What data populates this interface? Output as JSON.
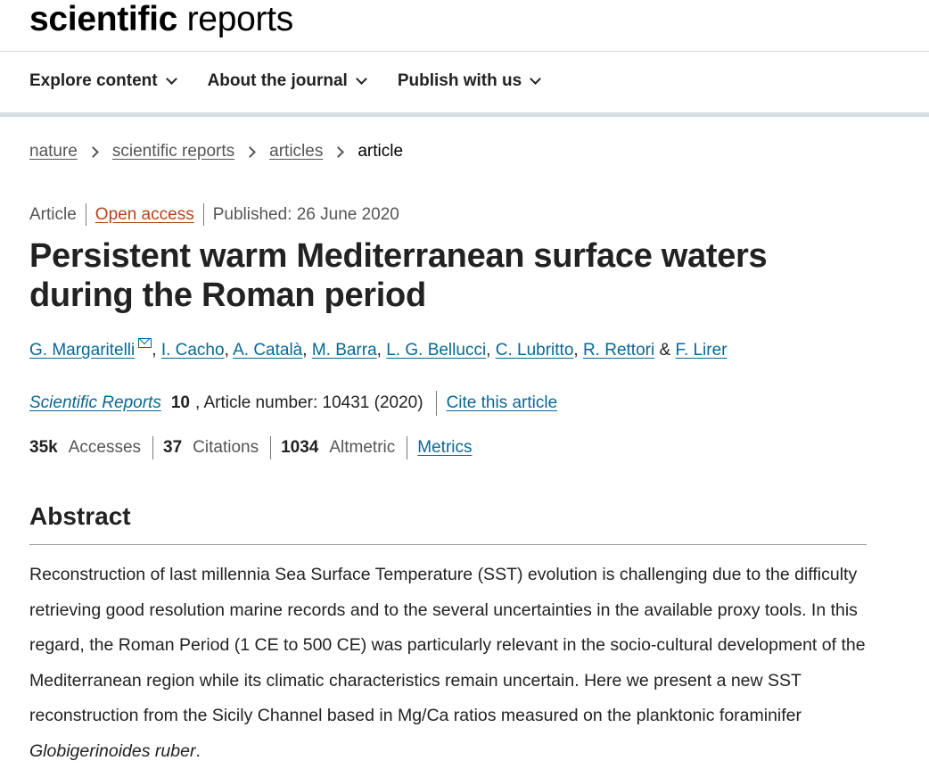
{
  "brand": {
    "bold": "scientific",
    "regular": " reports"
  },
  "nav": {
    "items": [
      {
        "label": "Explore content"
      },
      {
        "label": "About the journal"
      },
      {
        "label": "Publish with us"
      }
    ]
  },
  "breadcrumb": {
    "items": [
      {
        "label": "nature"
      },
      {
        "label": "scientific reports"
      },
      {
        "label": "articles"
      }
    ],
    "current": "article"
  },
  "meta": {
    "type": "Article",
    "access": "Open access",
    "published": "Published: 26 June 2020"
  },
  "article": {
    "title": "Persistent warm Mediterranean surface waters during the Roman period"
  },
  "authors": {
    "list": [
      "G. Margaritelli",
      "I. Cacho",
      "A. Català",
      "M. Barra",
      "L. G. Bellucci",
      "C. Lubritto",
      "R. Rettori"
    ],
    "last": "F. Lirer",
    "comma": ", ",
    "amp": " & "
  },
  "journal": {
    "name": "Scientific Reports",
    "volume": "10",
    "article_number": ", Article number: 10431 (2020)",
    "cite_label": "Cite this article"
  },
  "metrics": {
    "accesses_value": "35k",
    "accesses_label": "Accesses",
    "citations_value": "37",
    "citations_label": "Citations",
    "altmetric_value": "1034",
    "altmetric_label": "Altmetric",
    "metrics_link": "Metrics"
  },
  "abstract": {
    "heading": "Abstract",
    "text": "Reconstruction of last millennia Sea Surface Temperature (SST) evolution is challenging due to the difficulty retrieving good resolution marine records and to the several uncertainties in the available proxy tools. In this regard, the Roman Period (1 CE to 500 CE) was particularly relevant in the socio-cultural development of the Mediterranean region while its climatic characteristics remain uncertain. Here we present a new SST reconstruction from the Sicily Channel based in Mg/Ca ratios measured on the planktonic foraminifer ",
    "species": "Globigerinoides ruber",
    "end": "."
  }
}
